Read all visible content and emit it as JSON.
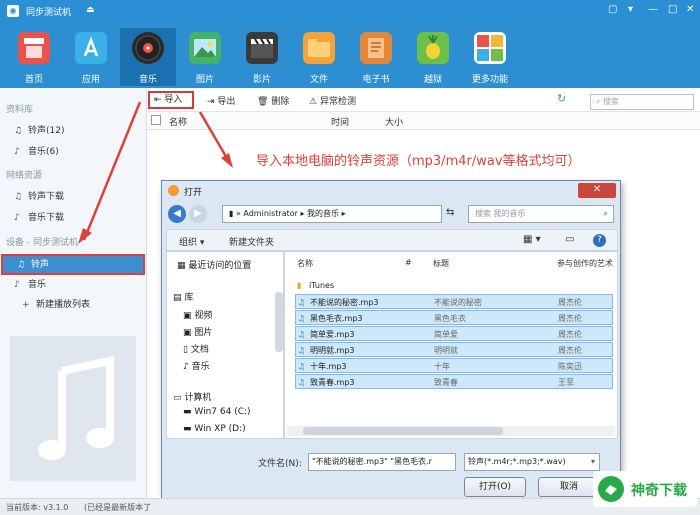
{
  "app": {
    "title": "同步测试机"
  },
  "toolbar": {
    "items": [
      {
        "label": "首页",
        "color": "#e8534b"
      },
      {
        "label": "应用",
        "color": "#3ab0e8"
      },
      {
        "label": "音乐",
        "color": "#2b2b2b"
      },
      {
        "label": "图片",
        "color": "#43b36a"
      },
      {
        "label": "影片",
        "color": "#3a3a3a"
      },
      {
        "label": "文件",
        "color": "#f2a33a"
      },
      {
        "label": "电子书",
        "color": "#e0873a"
      },
      {
        "label": "越狱",
        "color": "#6cc04a"
      },
      {
        "label": "更多功能",
        "color": "#e8534b"
      }
    ],
    "active": "音乐"
  },
  "sidebar": {
    "sections": [
      {
        "header": "资料库",
        "items": [
          {
            "label": "铃声(12)",
            "icon": "bell-icon"
          },
          {
            "label": "音乐(6)",
            "icon": "music-note-icon"
          }
        ]
      },
      {
        "header": "网络资源",
        "items": [
          {
            "label": "铃声下载",
            "icon": "bell-icon"
          },
          {
            "label": "音乐下载",
            "icon": "music-note-icon"
          }
        ]
      },
      {
        "header": "设备 - 同步测试机",
        "items": [
          {
            "label": "铃声",
            "icon": "bell-icon"
          },
          {
            "label": "音乐",
            "icon": "music-note-icon"
          },
          {
            "label": "新建播放列表",
            "icon": "plus-icon"
          }
        ]
      }
    ]
  },
  "main": {
    "actions": {
      "import": "导入",
      "export": "导出",
      "delete": "删除",
      "check": "异常检测"
    },
    "search_placeholder": "搜索",
    "columns": {
      "name": "名称",
      "duration": "时间",
      "size": "大小"
    }
  },
  "annotation": "导入本地电脑的铃声资源（mp3/m4r/wav等格式均可）",
  "dialog": {
    "title": "打开",
    "path": [
      "Administrator",
      "我的音乐"
    ],
    "search_placeholder": "搜索 我的音乐",
    "organize": "组织 ▾",
    "new_folder": "新建文件夹",
    "nav": {
      "recent": "最近访问的位置",
      "library": "库",
      "videos": "视频",
      "pictures": "图片",
      "documents": "文档",
      "music": "音乐",
      "computer": "计算机",
      "drive_c": "Win7 64 (C:)",
      "drive_d": "Win XP (D:)"
    },
    "headers": {
      "name": "名称",
      "num": "#",
      "title": "标题",
      "artist": "参与创作的艺术"
    },
    "folder": "iTunes",
    "files": [
      {
        "name": "不能说的秘密.mp3",
        "title": "不能说的秘密",
        "artist": "周杰伦"
      },
      {
        "name": "黑色毛衣.mp3",
        "title": "黑色毛衣",
        "artist": "周杰伦"
      },
      {
        "name": "简单爱.mp3",
        "title": "简单爱",
        "artist": "周杰伦"
      },
      {
        "name": "明明就.mp3",
        "title": "明明就",
        "artist": "周杰伦"
      },
      {
        "name": "十年.mp3",
        "title": "十年",
        "artist": "陈奕迅"
      },
      {
        "name": "致青春.mp3",
        "title": "致青春",
        "artist": "王菲"
      }
    ],
    "filename_label": "文件名(N):",
    "filename_value": "\"不能说的秘密.mp3\" \"黑色毛衣.r",
    "filetype_value": "铃声(*.m4r;*.mp3;*.wav)",
    "open_label": "打开(O)",
    "cancel_label": "取消"
  },
  "status": {
    "version": "当前版本: v3.1.0",
    "note": "(已经是最新版本了"
  },
  "watermark": "神奇下载"
}
